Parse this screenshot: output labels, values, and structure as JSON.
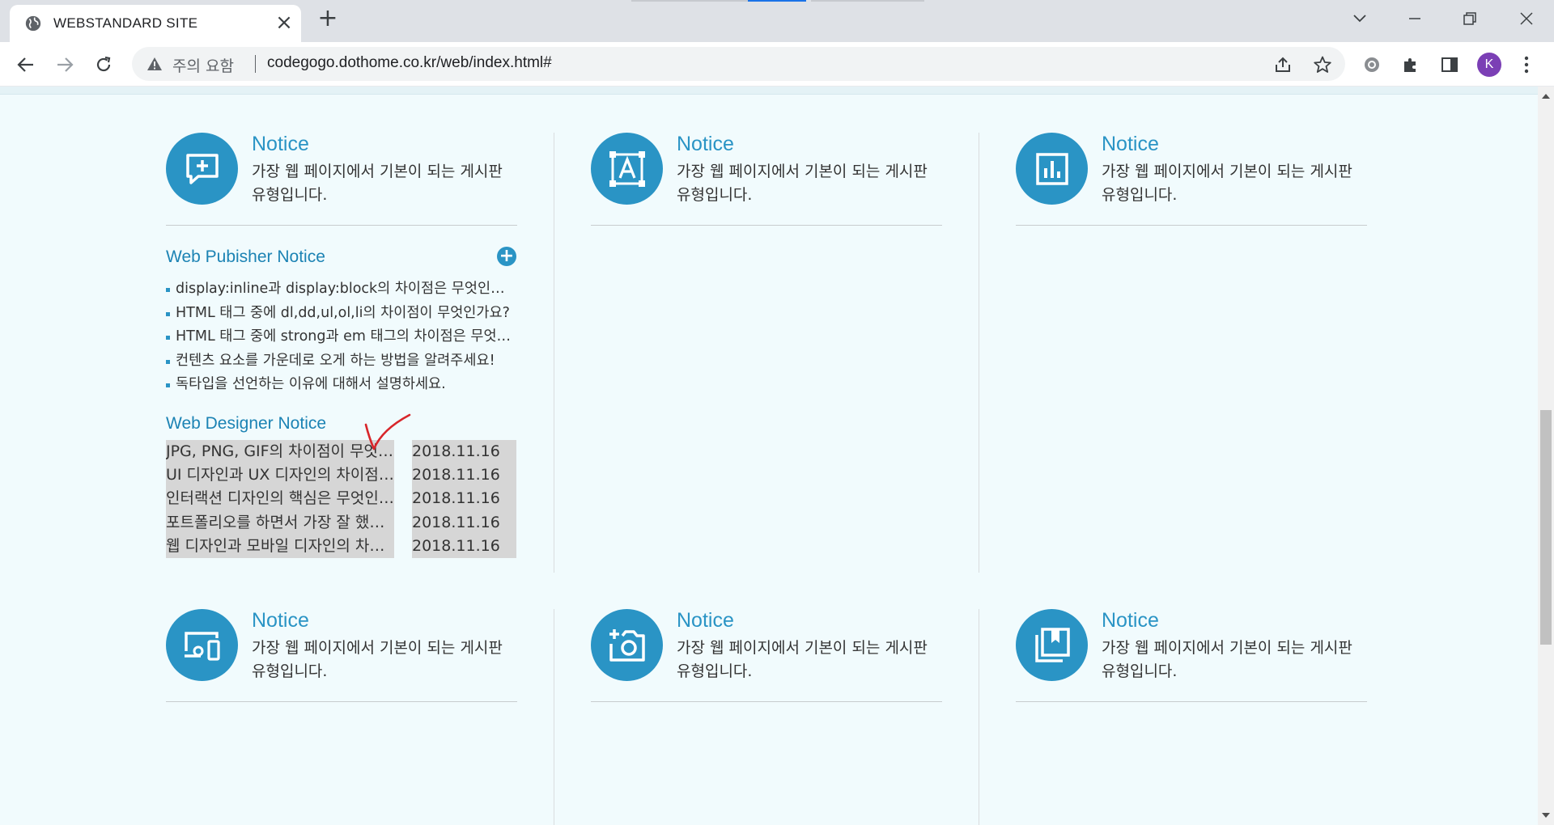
{
  "browser": {
    "tab_title": "WEBSTANDARD SITE",
    "security_warning": "주의 요함",
    "url": "codegogo.dothome.co.kr/web/index.html#",
    "profile_initial": "K",
    "accent": "#2a94c5"
  },
  "cards_row1": [
    {
      "title": "Notice",
      "desc": "가장 웹 페이지에서 기본이 되는 게시판 유형입니다.",
      "icon": "chat-plus-icon"
    },
    {
      "title": "Notice",
      "desc": "가장 웹 페이지에서 기본이 되는 게시판 유형입니다.",
      "icon": "text-frame-icon"
    },
    {
      "title": "Notice",
      "desc": "가장 웹 페이지에서 기본이 되는 게시판 유형입니다.",
      "icon": "bar-chart-icon"
    }
  ],
  "cards_row2": [
    {
      "title": "Notice",
      "desc": "가장 웹 페이지에서 기본이 되는 게시판 유형입니다.",
      "icon": "devices-icon"
    },
    {
      "title": "Notice",
      "desc": "가장 웹 페이지에서 기본이 되는 게시판 유형입니다.",
      "icon": "camera-plus-icon"
    },
    {
      "title": "Notice",
      "desc": "가장 웹 페이지에서 기본이 되는 게시판 유형입니다.",
      "icon": "library-icon"
    }
  ],
  "publisher": {
    "title": "Web Pubisher Notice",
    "items": [
      "display:inline과 display:block의 차이점은 무엇인가요?",
      "HTML 태그 중에 dl,dd,ul,ol,li의 차이점이 무엇인가요?",
      "HTML 태그 중에 strong과 em 태그의 차이점은 무엇인가요?",
      "컨텐츠 요소를 가운데로 오게 하는 방법을 알려주세요!",
      "독타입을 선언하는 이유에 대해서 설명하세요."
    ]
  },
  "designer": {
    "title": "Web Designer Notice",
    "rows": [
      {
        "title": "JPG, PNG, GIF의 차이점이 무엇인가요?",
        "date": "2018.11.16"
      },
      {
        "title": "UI 디자인과 UX 디자인의 차이점은?",
        "date": "2018.11.16"
      },
      {
        "title": "인터랙션 디자인의 핵심은 무엇인가요?",
        "date": "2018.11.16"
      },
      {
        "title": "포트폴리오를 하면서 가장 잘 했던 점은?",
        "date": "2018.11.16"
      },
      {
        "title": "웹 디자인과 모바일 디자인의 차이점은?",
        "date": "2018.11.16"
      }
    ]
  }
}
